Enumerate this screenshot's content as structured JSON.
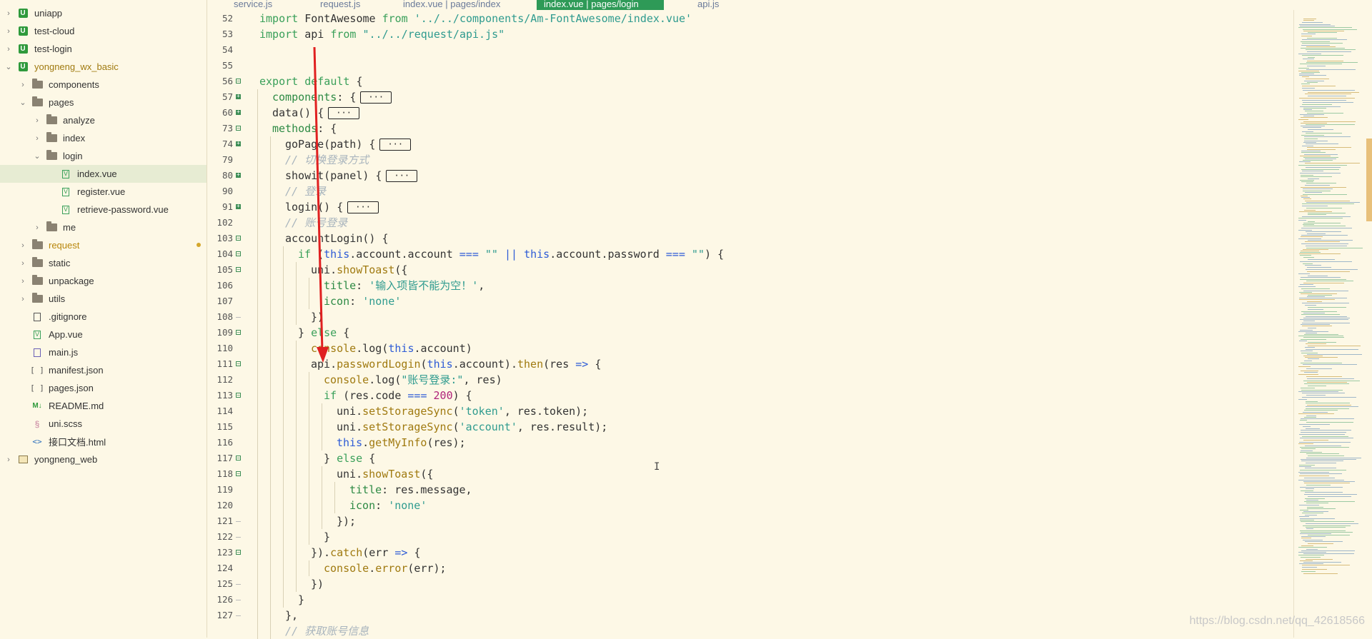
{
  "explorer": {
    "items": [
      {
        "label": "uniapp",
        "icon": "uniapp-project-icon",
        "depth": 0,
        "arrow": "right"
      },
      {
        "label": "test-cloud",
        "icon": "uniapp-project-icon",
        "depth": 0,
        "arrow": "right"
      },
      {
        "label": "test-login",
        "icon": "uniapp-project-icon",
        "depth": 0,
        "arrow": "right"
      },
      {
        "label": "yongneng_wx_basic",
        "icon": "uniapp-project-icon",
        "depth": 0,
        "arrow": "down"
      },
      {
        "label": "components",
        "icon": "folder-icon",
        "depth": 1,
        "arrow": "right"
      },
      {
        "label": "pages",
        "icon": "folder-icon",
        "depth": 1,
        "arrow": "down"
      },
      {
        "label": "analyze",
        "icon": "folder-icon",
        "depth": 2,
        "arrow": "right"
      },
      {
        "label": "index",
        "icon": "folder-icon",
        "depth": 2,
        "arrow": "right"
      },
      {
        "label": "login",
        "icon": "folder-icon",
        "depth": 2,
        "arrow": "down"
      },
      {
        "label": "index.vue",
        "icon": "vue-file-icon",
        "depth": 3,
        "arrow": "none"
      },
      {
        "label": "register.vue",
        "icon": "vue-file-icon",
        "depth": 3,
        "arrow": "none"
      },
      {
        "label": "retrieve-password.vue",
        "icon": "vue-file-icon",
        "depth": 3,
        "arrow": "none"
      },
      {
        "label": "me",
        "icon": "folder-icon",
        "depth": 2,
        "arrow": "right"
      },
      {
        "label": "request",
        "icon": "folder-icon",
        "depth": 1,
        "arrow": "right"
      },
      {
        "label": "static",
        "icon": "folder-icon",
        "depth": 1,
        "arrow": "right"
      },
      {
        "label": "unpackage",
        "icon": "folder-icon",
        "depth": 1,
        "arrow": "right"
      },
      {
        "label": "utils",
        "icon": "folder-icon",
        "depth": 1,
        "arrow": "right"
      },
      {
        "label": ".gitignore",
        "icon": "file-icon",
        "depth": 1,
        "arrow": "none"
      },
      {
        "label": "App.vue",
        "icon": "vue-file-icon",
        "depth": 1,
        "arrow": "none"
      },
      {
        "label": "main.js",
        "icon": "js-file-icon",
        "depth": 1,
        "arrow": "none"
      },
      {
        "label": "manifest.json",
        "icon": "json-file-icon",
        "depth": 1,
        "arrow": "none"
      },
      {
        "label": "pages.json",
        "icon": "json-file-icon",
        "depth": 1,
        "arrow": "none"
      },
      {
        "label": "README.md",
        "icon": "markdown-file-icon",
        "depth": 1,
        "arrow": "none"
      },
      {
        "label": "uni.scss",
        "icon": "scss-file-icon",
        "depth": 1,
        "arrow": "none"
      },
      {
        "label": "接口文档.html",
        "icon": "html-file-icon",
        "depth": 1,
        "arrow": "none"
      },
      {
        "label": "yongneng_web",
        "icon": "web-project-icon",
        "depth": 0,
        "arrow": "right"
      }
    ]
  },
  "tabs": [
    {
      "label": "service.js",
      "active": false
    },
    {
      "label": "request.js",
      "active": false
    },
    {
      "label": "index.vue | pages/index",
      "active": false
    },
    {
      "label": "index.vue | pages/login",
      "active": true
    },
    {
      "label": "api.js",
      "active": false
    }
  ],
  "code_lines": [
    {
      "n": "52",
      "fold": "",
      "indent": 0,
      "html": "<span class='k'>import</span> FontAwesome <span class='k'>from</span> <span class='st'>'../../components/Am-FontAwesome/index.vue'</span>"
    },
    {
      "n": "53",
      "fold": "",
      "indent": 0,
      "html": "<span class='k'>import</span> api <span class='k'>from</span> <span class='st'>\"../../request/api.js\"</span>"
    },
    {
      "n": "54",
      "fold": "",
      "indent": 0,
      "html": ""
    },
    {
      "n": "55",
      "fold": "",
      "indent": 0,
      "html": ""
    },
    {
      "n": "56",
      "fold": "minus",
      "indent": 0,
      "html": "<span class='k'>export</span> <span class='k'>default</span> {"
    },
    {
      "n": "57",
      "fold": "plus",
      "indent": 1,
      "html": "<span class='pr'>components</span>: {<span class='box'>···</span>"
    },
    {
      "n": "60",
      "fold": "plus",
      "indent": 1,
      "html": "data() {<span class='box'>···</span>"
    },
    {
      "n": "73",
      "fold": "minus",
      "indent": 1,
      "html": "<span class='pr'>methods</span>: {"
    },
    {
      "n": "74",
      "fold": "plus",
      "indent": 2,
      "html": "goPage(path) {<span class='box'>···</span>"
    },
    {
      "n": "79",
      "fold": "",
      "indent": 2,
      "html": "<span class='cm'>// 切换登录方式</span>"
    },
    {
      "n": "80",
      "fold": "plus",
      "indent": 2,
      "html": "showit(panel) {<span class='box'>···</span>"
    },
    {
      "n": "90",
      "fold": "",
      "indent": 2,
      "html": "<span class='cm'>// 登录</span>"
    },
    {
      "n": "91",
      "fold": "plus",
      "indent": 2,
      "html": "login() {<span class='box'>···</span>"
    },
    {
      "n": "102",
      "fold": "",
      "indent": 2,
      "html": "<span class='cm'>// 账号登录</span>"
    },
    {
      "n": "103",
      "fold": "minus",
      "indent": 2,
      "html": "accountLogin() {"
    },
    {
      "n": "104",
      "fold": "minus",
      "indent": 3,
      "html": "<span class='k'>if</span> (<span class='kw'>this</span>.account.account <span class='kw'>===</span> <span class='st'>\"\"</span> <span class='kw'>||</span> <span class='kw'>this</span>.account.password <span class='kw'>===</span> <span class='st'>\"\"</span>) {"
    },
    {
      "n": "105",
      "fold": "minus",
      "indent": 4,
      "html": "uni.<span class='fn'>showToast</span>({"
    },
    {
      "n": "106",
      "fold": "",
      "indent": 5,
      "html": "<span class='pr'>title</span>: <span class='st'>'输入项皆不能为空！'</span>,"
    },
    {
      "n": "107",
      "fold": "",
      "indent": 5,
      "html": "<span class='pr'>icon</span>: <span class='st'>'none'</span>"
    },
    {
      "n": "108",
      "fold": "tick",
      "indent": 4,
      "html": "})"
    },
    {
      "n": "109",
      "fold": "minus",
      "indent": 3,
      "html": "} <span class='k'>else</span> {"
    },
    {
      "n": "110",
      "fold": "",
      "indent": 4,
      "html": "<span class='fn'>console</span>.log(<span class='kw'>this</span>.account)"
    },
    {
      "n": "111",
      "fold": "minus",
      "indent": 4,
      "html": "api.<span class='fn'>passwordLogin</span>(<span class='kw'>this</span>.account).<span class='fn'>then</span>(res <span class='kw'>=&gt;</span> {"
    },
    {
      "n": "112",
      "fold": "",
      "indent": 5,
      "html": "<span class='fn'>console</span>.log(<span class='st'>\"账号登录:\"</span>, res)"
    },
    {
      "n": "113",
      "fold": "minus",
      "indent": 5,
      "html": "<span class='k'>if</span> (res.code <span class='kw'>===</span> <span class='num'>200</span>) {"
    },
    {
      "n": "114",
      "fold": "",
      "indent": 6,
      "html": "uni.<span class='fn'>setStorageSync</span>(<span class='st'>'token'</span>, res.token);"
    },
    {
      "n": "115",
      "fold": "",
      "indent": 6,
      "html": "uni.<span class='fn'>setStorageSync</span>(<span class='st'>'account'</span>, res.result);"
    },
    {
      "n": "116",
      "fold": "",
      "indent": 6,
      "html": "<span class='kw'>this</span>.<span class='fn'>getMyInfo</span>(res);"
    },
    {
      "n": "117",
      "fold": "minus",
      "indent": 5,
      "html": "} <span class='k'>else</span> {"
    },
    {
      "n": "118",
      "fold": "minus",
      "indent": 6,
      "html": "uni.<span class='fn'>showToast</span>({"
    },
    {
      "n": "119",
      "fold": "",
      "indent": 7,
      "html": "<span class='pr'>title</span>: res.message,"
    },
    {
      "n": "120",
      "fold": "",
      "indent": 7,
      "html": "<span class='pr'>icon</span>: <span class='st'>'none'</span>"
    },
    {
      "n": "121",
      "fold": "tick",
      "indent": 6,
      "html": "});"
    },
    {
      "n": "122",
      "fold": "tick",
      "indent": 5,
      "html": "}"
    },
    {
      "n": "123",
      "fold": "minus",
      "indent": 4,
      "html": "}).<span class='fn'>catch</span>(err <span class='kw'>=&gt;</span> {"
    },
    {
      "n": "124",
      "fold": "",
      "indent": 5,
      "html": "<span class='fn'>console</span>.<span class='fn'>error</span>(err);"
    },
    {
      "n": "125",
      "fold": "tick",
      "indent": 4,
      "html": "})"
    },
    {
      "n": "126",
      "fold": "tick",
      "indent": 3,
      "html": "}"
    },
    {
      "n": "127",
      "fold": "tick",
      "indent": 2,
      "html": "},"
    },
    {
      "n": "",
      "fold": "",
      "indent": 2,
      "html": "<span class='cm'>// 获取账号信息</span>"
    }
  ],
  "watermark": "https://blog.csdn.net/qq_42618566",
  "colors": {
    "accent": "#2e9a57",
    "background": "#fdf8e6",
    "annotation_arrow": "#e02020"
  }
}
